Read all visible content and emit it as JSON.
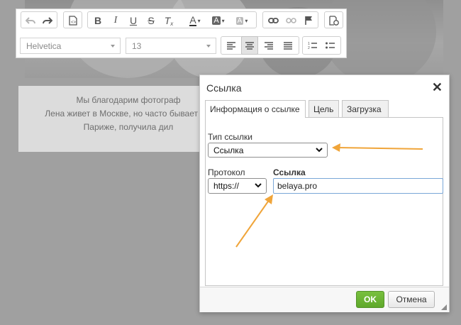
{
  "editor": {
    "toolbar": {
      "undo_icon": "undo-icon",
      "redo_icon": "redo-icon",
      "font_family": "Helvetica",
      "font_size": "13"
    },
    "content_lines": [
      "Мы благодарим фотограф",
      "Лена живет в Москве, но часто бывает в р",
      "Париже, получила дил"
    ]
  },
  "dialog": {
    "title": "Ссылка",
    "tabs": [
      "Информация о ссылке",
      "Цель",
      "Загрузка"
    ],
    "link_type_label": "Тип ссылки",
    "link_type_value": "Ссылка",
    "protocol_label": "Протокол",
    "protocol_value": "https://",
    "url_label": "Ссылка",
    "url_value": "belaya.pro",
    "ok_label": "OK",
    "cancel_label": "Отмена"
  },
  "colors": {
    "arrow": "#f0a53a",
    "ok_button": "#6db435",
    "input_border": "#7aa7d8"
  }
}
